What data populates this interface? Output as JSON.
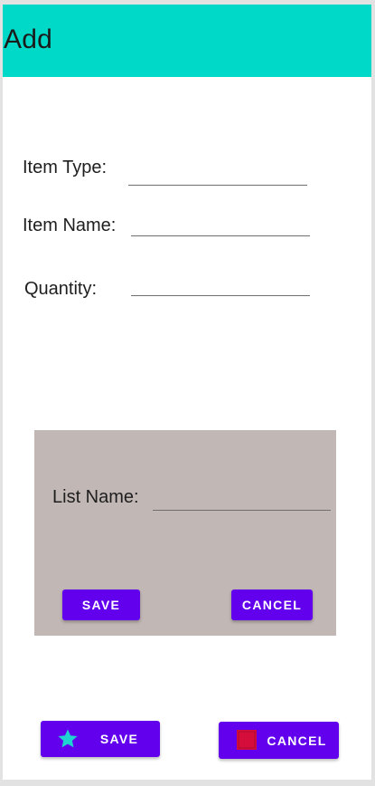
{
  "app_bar": {
    "title": "Add",
    "color": "#00d8c8"
  },
  "form": {
    "item_type": {
      "label": "Item Type:",
      "value": ""
    },
    "item_name": {
      "label": "Item Name:",
      "value": ""
    },
    "quantity": {
      "label": "Quantity:",
      "value": ""
    }
  },
  "dialog": {
    "background": "#c1b7b5",
    "list_name": {
      "label": "List Name:",
      "value": ""
    },
    "save_label": "SAVE",
    "cancel_label": "CANCEL"
  },
  "footer": {
    "save_label": "SAVE",
    "save_icon": "star-icon",
    "save_icon_color": "#1fd3d0",
    "cancel_label": "CANCEL",
    "cancel_icon": "red-square-icon",
    "cancel_icon_color": "#d40d3a"
  },
  "accent_color": "#6200ee"
}
